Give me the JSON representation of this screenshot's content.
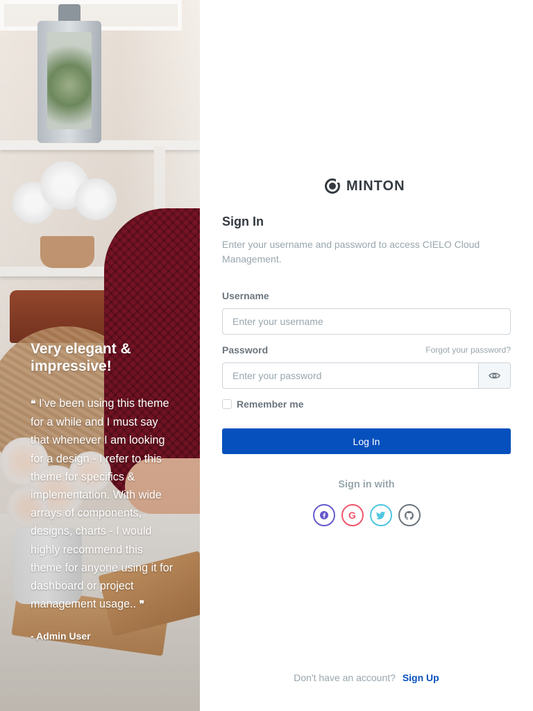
{
  "testimonial": {
    "heading": "Very elegant & impressive!",
    "open_quote": "❝",
    "text": "I've been using this theme for a while and I must say that whenever I am looking for a design - I refer to this theme for specifics & implementation. With wide arrays of components, designs, charts - I would highly recommend this theme for anyone using it for dashboard or project management usage..",
    "close_quote": "❞",
    "author": "- Admin User"
  },
  "brand": {
    "name": "MINTON",
    "icon": "logo-ring-icon"
  },
  "signin": {
    "title": "Sign In",
    "subtitle": "Enter your username and password to access CIELO Cloud Management."
  },
  "form": {
    "username_label": "Username",
    "username_placeholder": "Enter your username",
    "username_value": "",
    "password_label": "Password",
    "password_placeholder": "Enter your password",
    "password_value": "",
    "forgot_link": "Forgot your password?",
    "remember_label": "Remember me",
    "remember_checked": false,
    "submit_label": "Log In",
    "toggle_icon": "eye-icon"
  },
  "social": {
    "heading": "Sign in with",
    "providers": [
      {
        "name": "facebook",
        "glyph": "f",
        "color": "#6559cc"
      },
      {
        "name": "google",
        "glyph": "G",
        "color": "#f1556c"
      },
      {
        "name": "twitter",
        "glyph": "t",
        "color": "#4fc6e1"
      },
      {
        "name": "github",
        "glyph": "gh",
        "color": "#6c757d"
      }
    ]
  },
  "footer": {
    "prompt": "Don't have an account?",
    "signup_link": "Sign Up"
  },
  "colors": {
    "primary": "#0650bd",
    "muted": "#98a6ad",
    "heading": "#343a40"
  }
}
